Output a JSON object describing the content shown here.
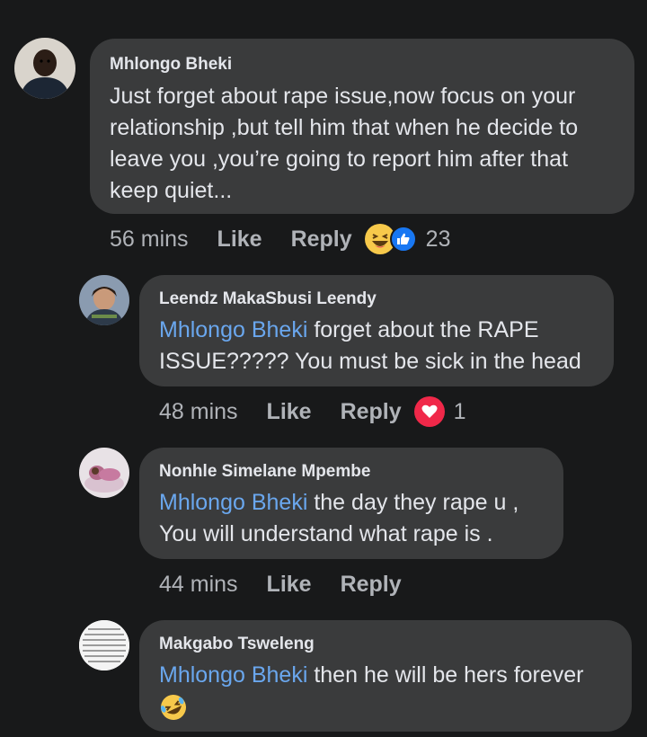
{
  "comments": [
    {
      "author": "Mhlongo Bheki",
      "mention": "",
      "text": "Just forget about rape issue,now focus on your relationship ,but tell him that when he decide to leave you ,you’re going to report him after that keep quiet...",
      "time": "56 mins",
      "like": "Like",
      "reply": "Reply",
      "reactions": [
        "haha-icon",
        "like-icon"
      ],
      "reaction_count": "23"
    },
    {
      "author": "Leendz MakaSbusi Leendy",
      "mention": "Mhlongo Bheki",
      "text": " forget about the RAPE ISSUE????? You must be sick in the head",
      "time": "48 mins",
      "like": "Like",
      "reply": "Reply",
      "reactions": [
        "love-icon"
      ],
      "reaction_count": "1"
    },
    {
      "author": "Nonhle Simelane Mpembe",
      "mention": "Mhlongo Bheki",
      "text": " the day they rape u , You will understand what rape is .",
      "time": "44 mins",
      "like": "Like",
      "reply": "Reply"
    },
    {
      "author": "Makgabo Tsweleng",
      "mention": "Mhlongo Bheki",
      "text": " then he will be hers forever",
      "emoji": "rolling-laughing-emoji"
    }
  ],
  "colors": {
    "background": "#18191a",
    "bubble": "#3a3b3c",
    "mention": "#6aa7ee",
    "meta": "#b0b3b8",
    "like_blue": "#1877f2",
    "love_red": "#f02849",
    "haha_yellow": "#f7c94b"
  }
}
